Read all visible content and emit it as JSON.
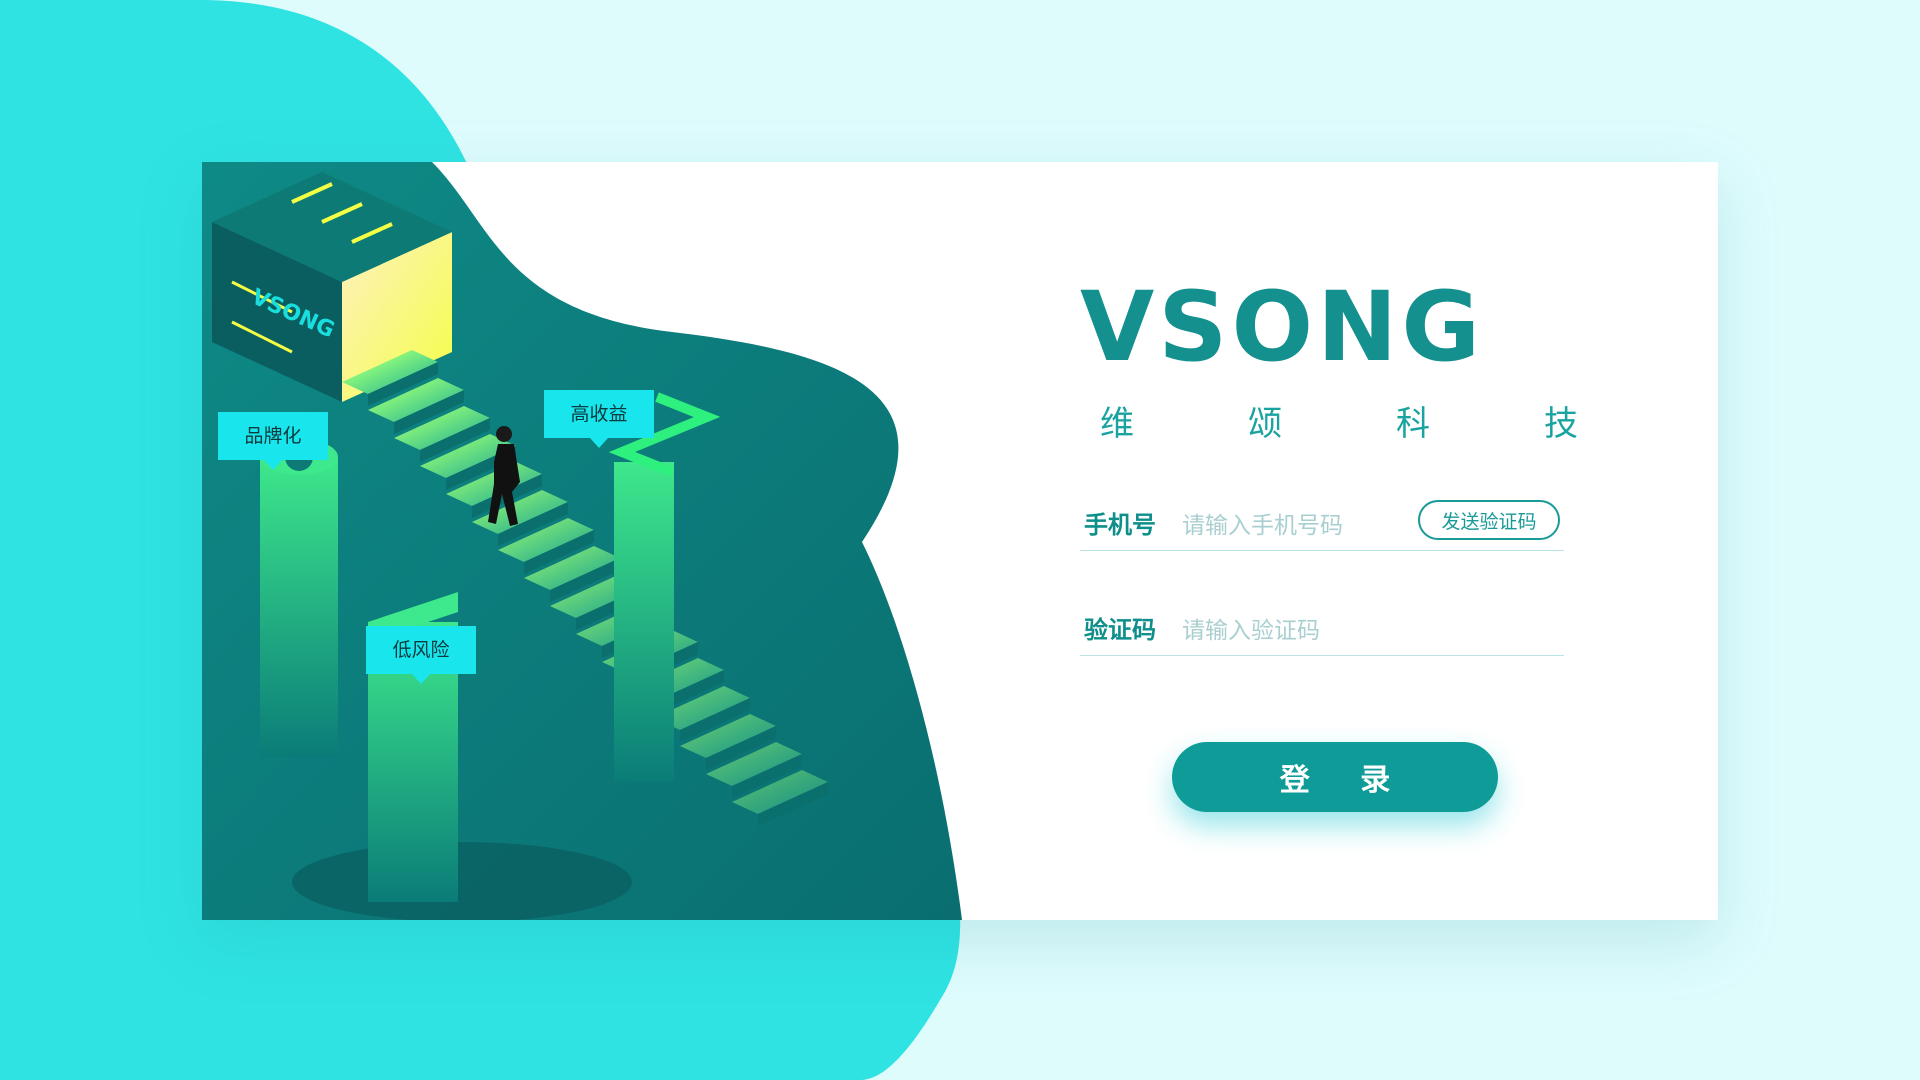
{
  "brand": {
    "wordmark": "VSONG",
    "tagline": [
      "维",
      "颂",
      "科",
      "技"
    ]
  },
  "illustration": {
    "bubbles": {
      "branding": "品牌化",
      "high_return": "高收益",
      "low_risk": "低风险"
    },
    "box_label": "VSONG"
  },
  "form": {
    "phone": {
      "label": "手机号",
      "placeholder": "请输入手机号码",
      "send_code_label": "发送验证码"
    },
    "code": {
      "label": "验证码",
      "placeholder": "请输入验证码"
    },
    "login_label": "登 录"
  },
  "colors": {
    "accent": "#0f9c98",
    "cyan": "#19e6ec",
    "page_background": "#dffcfd",
    "blob": "#2fe3e3"
  }
}
